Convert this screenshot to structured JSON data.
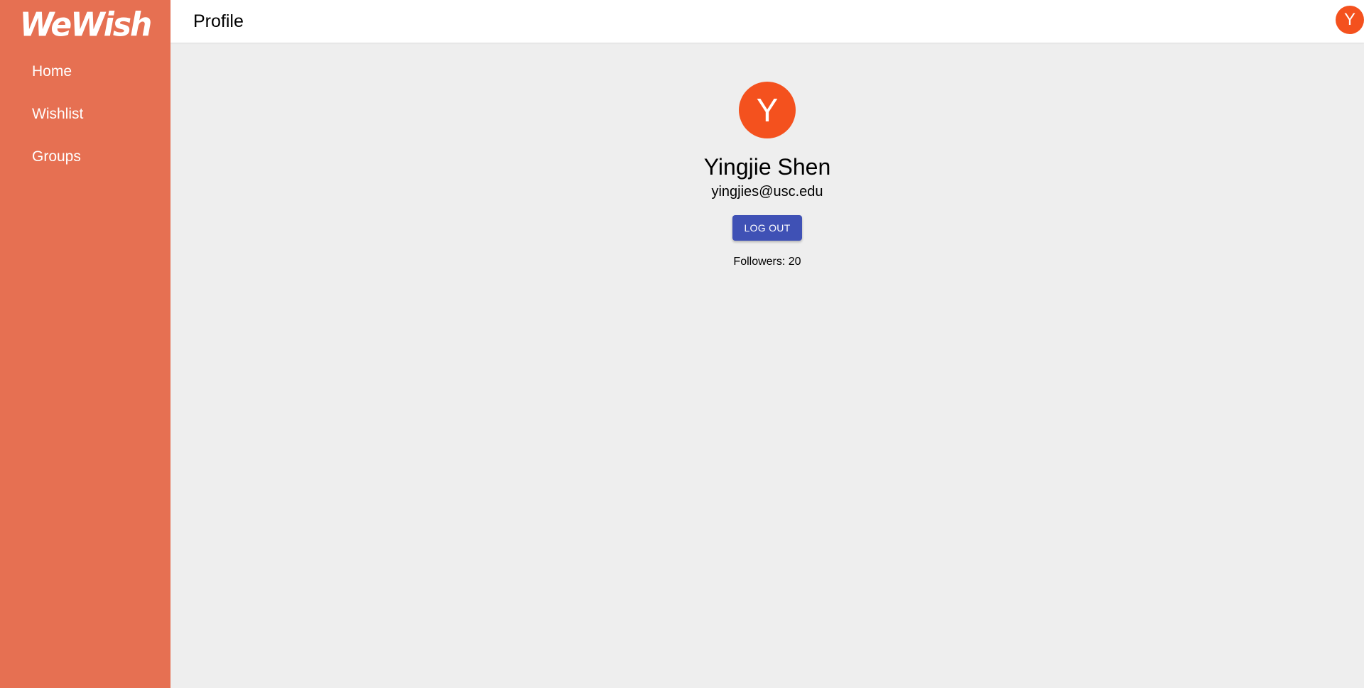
{
  "sidebar": {
    "logo": "WeWish",
    "items": [
      {
        "label": "Home"
      },
      {
        "label": "Wishlist"
      },
      {
        "label": "Groups"
      }
    ]
  },
  "header": {
    "title": "Profile",
    "avatar_letter": "Y"
  },
  "profile": {
    "avatar_letter": "Y",
    "name": "Yingjie Shen",
    "email": "yingjies@usc.edu",
    "logout_label": "LOG OUT",
    "followers_text": "Followers: 20"
  },
  "colors": {
    "sidebar_bg": "#e67052",
    "avatar_bg": "#f4511e",
    "button_bg": "#3f51b5",
    "content_bg": "#eeeeee"
  }
}
